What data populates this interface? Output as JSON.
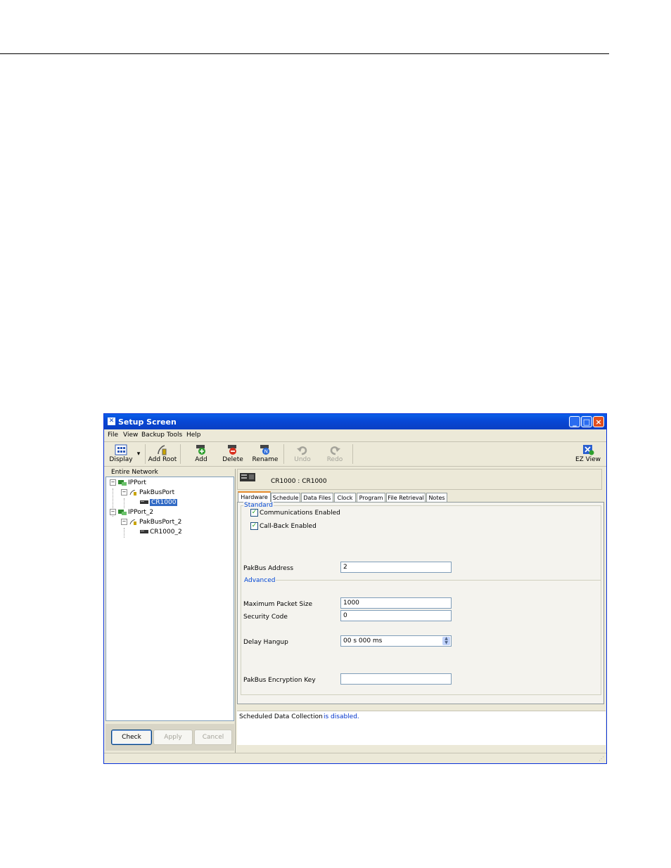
{
  "window": {
    "title": "Setup Screen",
    "controls": [
      "_",
      "□",
      "×"
    ]
  },
  "menu": [
    "File",
    "View",
    "Backup",
    "Tools",
    "Help"
  ],
  "toolbar": {
    "display": "Display",
    "add_root": "Add Root",
    "add": "Add",
    "delete": "Delete",
    "rename": "Rename",
    "undo": "Undo",
    "redo": "Redo",
    "ez_view": "EZ View"
  },
  "tree": {
    "header": "Entire Network",
    "nodes": [
      "IPPort",
      "PakBusPort",
      "CR1000",
      "IPPort_2",
      "PakBusPort_2",
      "CR1000_2"
    ]
  },
  "left_buttons": {
    "check": "Check",
    "apply": "Apply",
    "cancel": "Cancel"
  },
  "device_header": "CR1000 : CR1000",
  "tabs": [
    "Hardware",
    "Schedule",
    "Data Files",
    "Clock",
    "Program",
    "File Retrieval",
    "Notes"
  ],
  "hardware": {
    "standard_label": "Standard",
    "comms_enabled": "Communications Enabled",
    "callback_enabled": "Call-Back Enabled",
    "pakbus_address_label": "PakBus Address",
    "pakbus_address": "2",
    "advanced_label": "Advanced",
    "max_packet_label": "Maximum Packet Size",
    "max_packet": "1000",
    "security_label": "Security Code",
    "security": "0",
    "delay_label": "Delay Hangup",
    "delay": "00 s 000 ms",
    "encryption_label": "PakBus Encryption Key",
    "encryption": ""
  },
  "status": {
    "prefix": "Scheduled Data Collection",
    "state": "is disabled."
  }
}
